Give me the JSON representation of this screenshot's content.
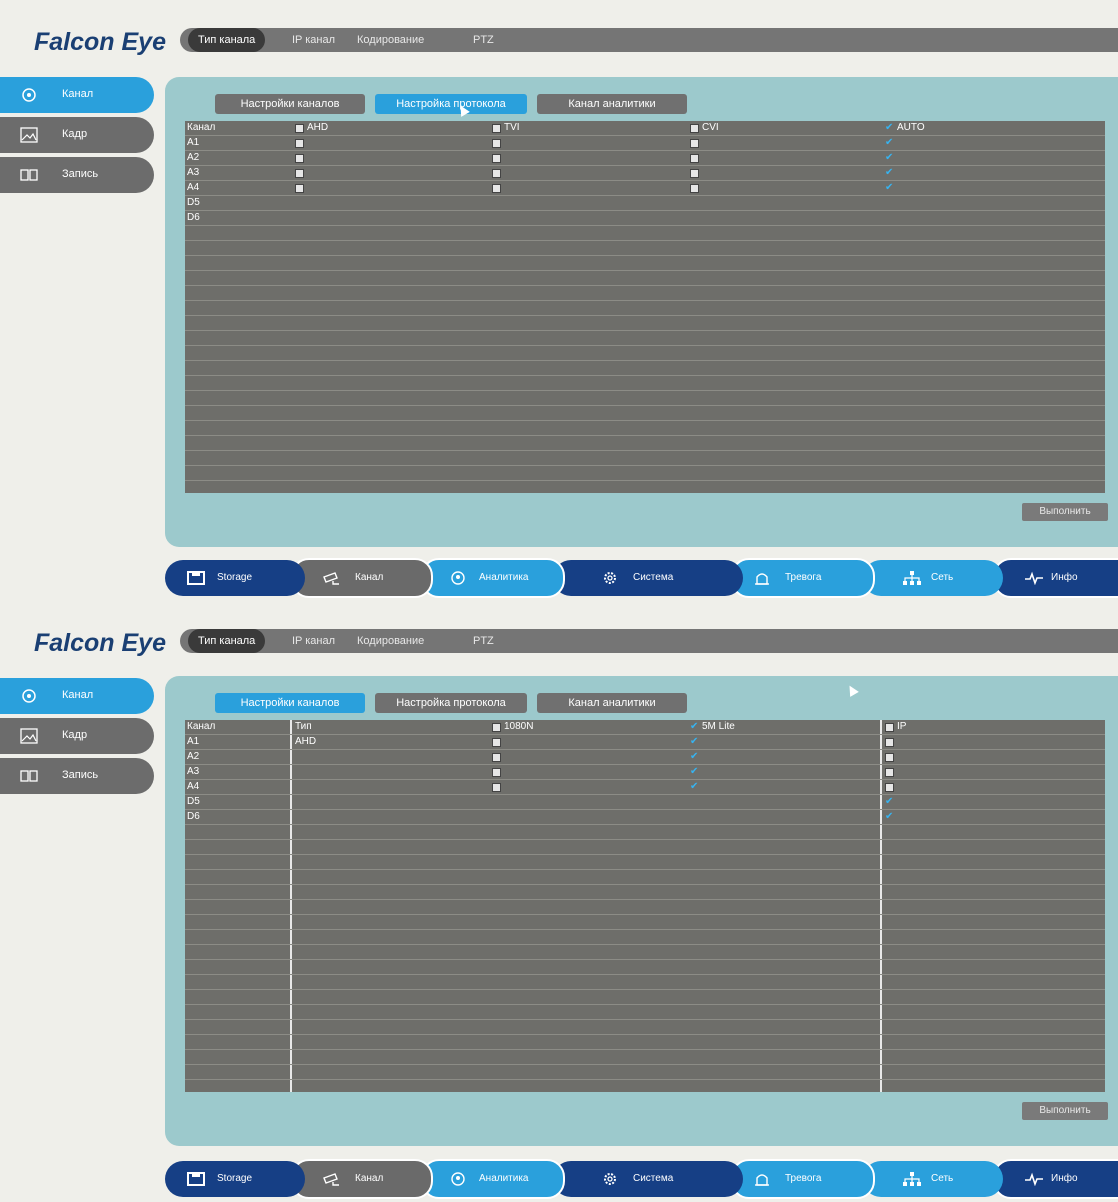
{
  "logo": {
    "brand": "Falcon Eye"
  },
  "top_tabs": [
    "Тип канала",
    "IP канал",
    "Кодирование",
    "PTZ"
  ],
  "sidebar": [
    {
      "label": "Канал",
      "icon": "camera-icon",
      "active": true
    },
    {
      "label": "Кадр",
      "icon": "image-icon",
      "active": false
    },
    {
      "label": "Запись",
      "icon": "record-icon",
      "active": false
    }
  ],
  "subtabs": [
    "Настройки каналов",
    "Настройка протокола",
    "Канал аналитики"
  ],
  "screen1": {
    "active_subtab": "Настройка протокола",
    "headers": [
      "Канал",
      "AHD",
      "TVI",
      "CVI",
      "AUTO"
    ],
    "channels": [
      "A1",
      "A2",
      "A3",
      "A4",
      "D5",
      "D6"
    ]
  },
  "screen2": {
    "active_subtab": "Настройки каналов",
    "headers": [
      "Канал",
      "Тип",
      "1080N",
      "5M Lite",
      "IP"
    ],
    "channels": [
      "A1",
      "A2",
      "A3",
      "A4",
      "D5",
      "D6"
    ],
    "type_values": [
      "AHD",
      "",
      "",
      "",
      "",
      ""
    ]
  },
  "execute_label": "Выполнить",
  "bottom_nav": [
    {
      "label": "Storage",
      "icon": "storage-icon",
      "color": "#163f85"
    },
    {
      "label": "Канал",
      "icon": "cctv-camera-icon",
      "color": "#6a6a6a"
    },
    {
      "label": "Аналитика",
      "icon": "analytics-head-icon",
      "color": "#2aa0dc"
    },
    {
      "label": "Система",
      "icon": "gear-icon",
      "color": "#163f85"
    },
    {
      "label": "Тревога",
      "icon": "alarm-icon",
      "color": "#2aa0dc"
    },
    {
      "label": "Сеть",
      "icon": "network-icon",
      "color": "#2aa0dc"
    },
    {
      "label": "Инфо",
      "icon": "pulse-icon",
      "color": "#ffffff"
    }
  ]
}
